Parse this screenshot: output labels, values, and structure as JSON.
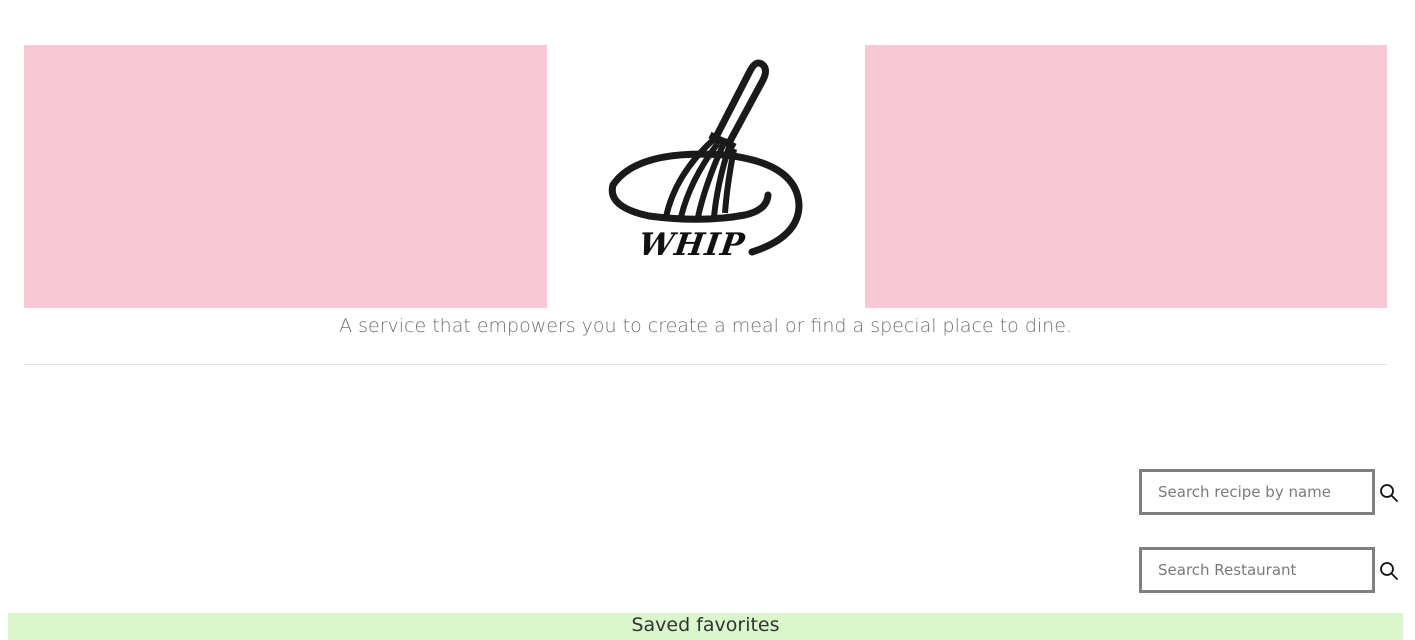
{
  "brand": {
    "logo_text": "WHIP"
  },
  "header": {
    "tagline": "A service that empowers you to create a meal or find a special place to dine."
  },
  "search": {
    "recipe_placeholder": "Search recipe by name",
    "restaurant_placeholder": "Search Restaurant"
  },
  "favorites": {
    "label": "Saved favorites"
  },
  "icons": {
    "logo": "whisk-bowl-icon",
    "search": "search-icon"
  },
  "colors": {
    "banner": "#f8c8d4",
    "favorites_bar": "#d9f6cd",
    "input_border": "#808080"
  }
}
